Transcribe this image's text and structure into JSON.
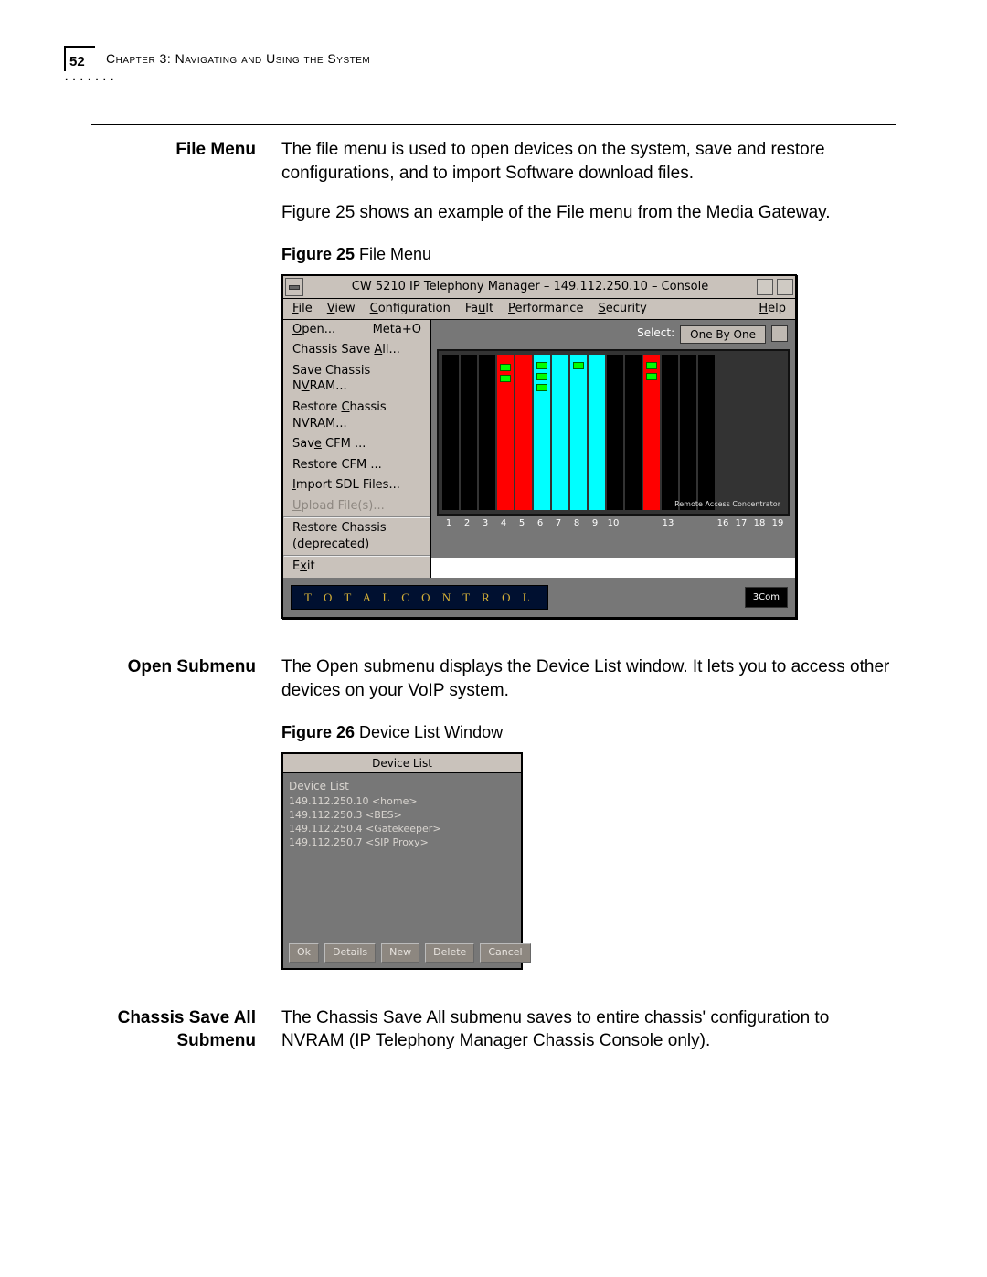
{
  "header": {
    "page_number": "52",
    "chapter": "Chapter 3: Navigating and Using the System"
  },
  "sections": {
    "file_menu": {
      "label": "File Menu",
      "p1": "The file menu is used to open devices on the system, save and restore configurations, and to import Software download files.",
      "p2": "Figure 25 shows an example of the File menu from the Media Gateway."
    },
    "open_submenu": {
      "label": "Open Submenu",
      "p1": "The Open submenu displays the Device List window. It lets you to access other devices on your VoIP system."
    },
    "chassis_save_all": {
      "label_l1": "Chassis Save All",
      "label_l2": "Submenu",
      "p1": "The Chassis Save All submenu saves to entire chassis' configuration to NVRAM (IP Telephony Manager Chassis Console only)."
    }
  },
  "figures": {
    "f25": {
      "caption_bold": "Figure 25",
      "caption_rest": "  File Menu"
    },
    "f26": {
      "caption_bold": "Figure 26",
      "caption_rest": "  Device List Window"
    }
  },
  "fig25": {
    "title": "CW 5210 IP Telephony Manager – 149.112.250.10 – Console",
    "menubar": {
      "file": "File",
      "view": "View",
      "config": "Configuration",
      "fault": "Fault",
      "perf": "Performance",
      "security": "Security",
      "help": "Help"
    },
    "file_items": {
      "open": "Open...",
      "open_accel": "Meta+O",
      "chassis_save_all": "Chassis Save All...",
      "save_nvram": "Save Chassis NVRAM...",
      "restore_nvram": "Restore Chassis NVRAM...",
      "save_cfm": "Save CFM ...",
      "restore_cfm": "Restore CFM ...",
      "import_sdl": "Import SDL Files...",
      "upload": "Upload File(s)...",
      "restore_dep": "Restore Chassis (deprecated)",
      "exit": "Exit"
    },
    "select_label": "Select:",
    "select_value": "One By One",
    "slot_numbers": [
      "1",
      "2",
      "3",
      "4",
      "5",
      "6",
      "7",
      "8",
      "9",
      "10",
      "",
      "",
      "13",
      "",
      "",
      "16",
      "17",
      "18",
      "19"
    ],
    "rac_label": "Remote Access Concentrator",
    "footer_brand": "T O T A L   C O N T R O L",
    "logo": "3Com"
  },
  "fig26": {
    "title": "Device List",
    "list_header": "Device List",
    "items": [
      "149.112.250.10 <home>",
      "149.112.250.3 <BES>",
      "149.112.250.4 <Gatekeeper>",
      "149.112.250.7 <SIP Proxy>"
    ],
    "buttons": {
      "ok": "Ok",
      "details": "Details",
      "new": "New",
      "delete": "Delete",
      "cancel": "Cancel"
    }
  }
}
